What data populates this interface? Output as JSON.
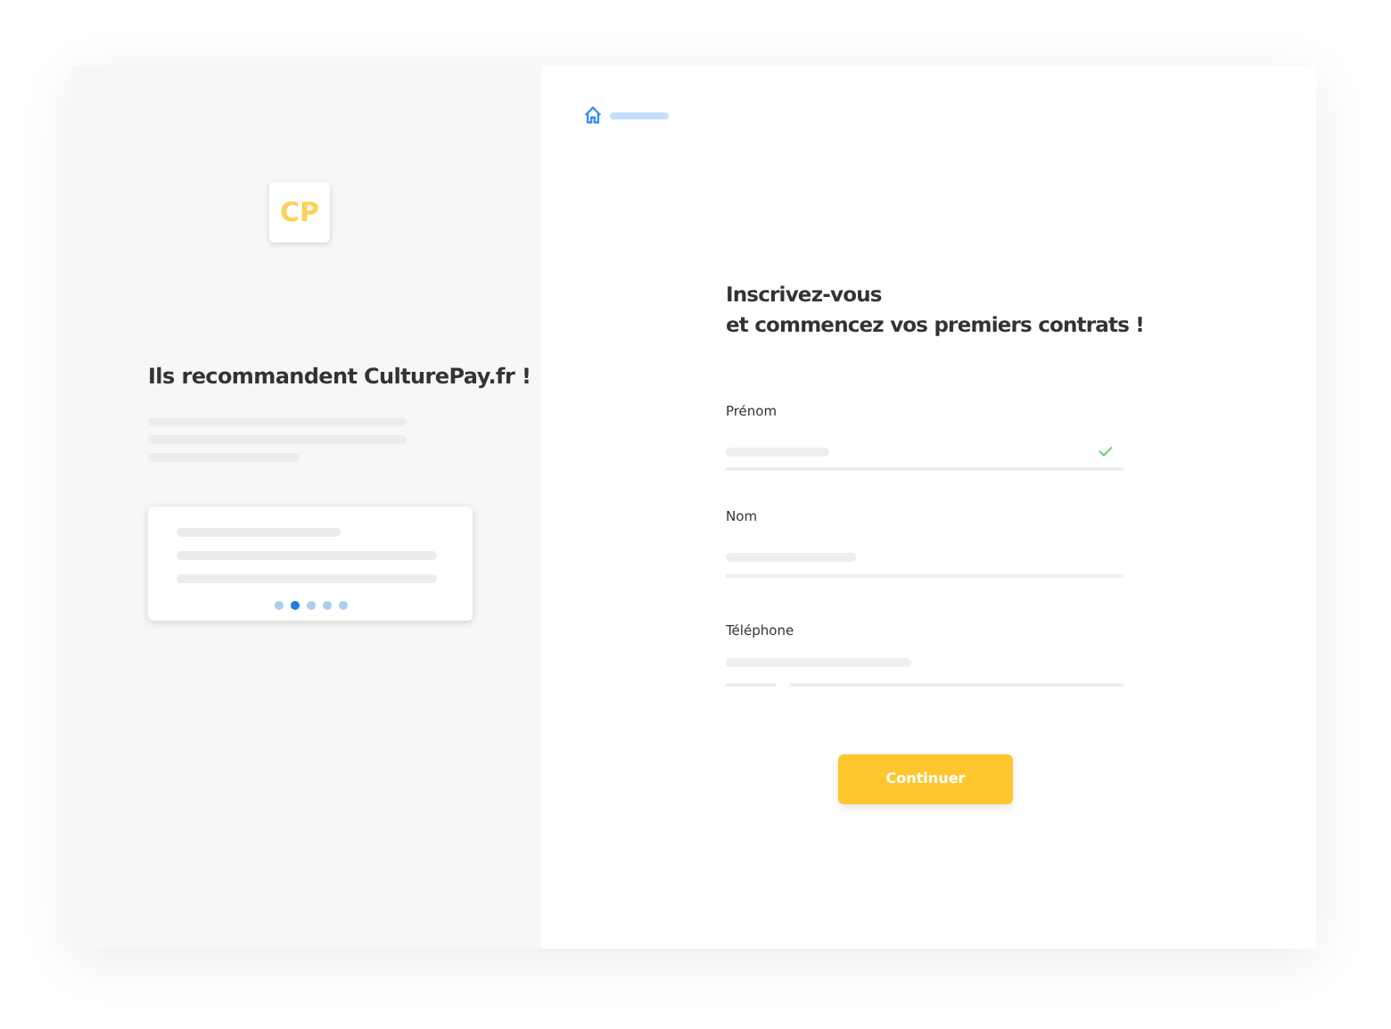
{
  "sidebar": {
    "logo": "CP",
    "title": "Ils recommandent CulturePay.fr !",
    "carousel_dots": [
      {
        "selected": false
      },
      {
        "selected": true
      },
      {
        "selected": false
      },
      {
        "selected": false
      },
      {
        "selected": false
      }
    ]
  },
  "form": {
    "heading_lines": [
      "Inscrivez-vous",
      "et commencez vos premiers contrats !"
    ],
    "fields": [
      {
        "label": "Prénom",
        "kind": "text",
        "valid": true
      },
      {
        "label": "Nom",
        "kind": "text",
        "valid": false
      },
      {
        "label": "Téléphone",
        "kind": "phone",
        "valid": false
      }
    ],
    "submit": "Continuer"
  }
}
